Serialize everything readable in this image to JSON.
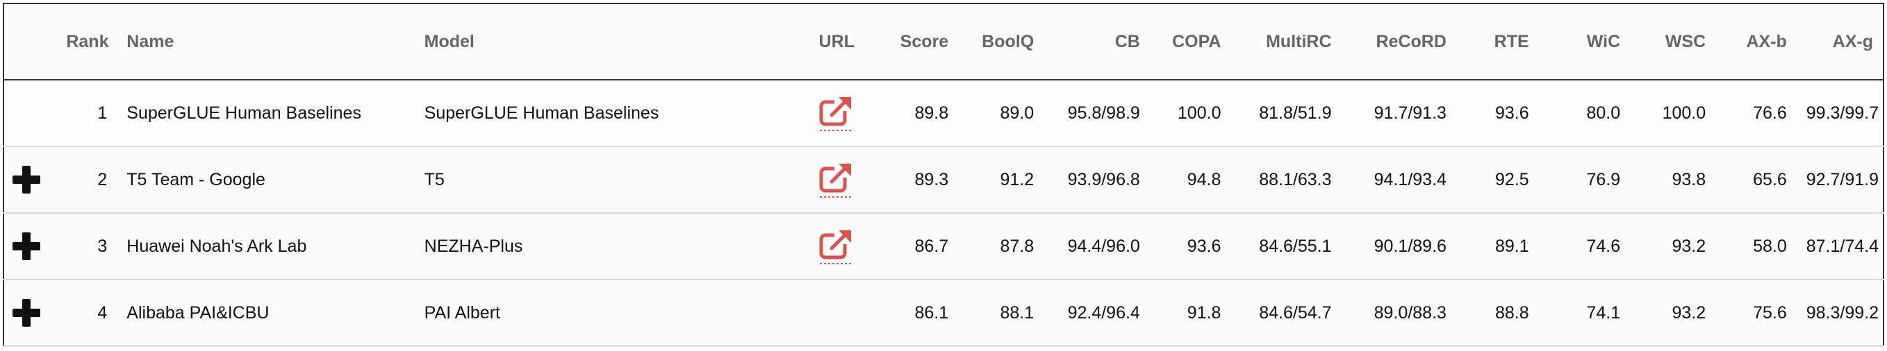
{
  "columns": {
    "rank": "Rank",
    "name": "Name",
    "model": "Model",
    "url": "URL",
    "score": "Score",
    "boolq": "BoolQ",
    "cb": "CB",
    "copa": "COPA",
    "multirc": "MultiRC",
    "record": "ReCoRD",
    "rte": "RTE",
    "wic": "WiC",
    "wsc": "WSC",
    "axb": "AX-b",
    "axg": "AX-g"
  },
  "rows": [
    {
      "rank": "1",
      "name": "SuperGLUE Human Baselines",
      "model": "SuperGLUE Human Baselines",
      "has_url": true,
      "expandable": false,
      "score": "89.8",
      "boolq": "89.0",
      "cb": "95.8/98.9",
      "copa": "100.0",
      "multirc": "81.8/51.9",
      "record": "91.7/91.3",
      "rte": "93.6",
      "wic": "80.0",
      "wsc": "100.0",
      "axb": "76.6",
      "axg": "99.3/99.7"
    },
    {
      "rank": "2",
      "name": "T5 Team - Google",
      "model": "T5",
      "has_url": true,
      "expandable": true,
      "score": "89.3",
      "boolq": "91.2",
      "cb": "93.9/96.8",
      "copa": "94.8",
      "multirc": "88.1/63.3",
      "record": "94.1/93.4",
      "rte": "92.5",
      "wic": "76.9",
      "wsc": "93.8",
      "axb": "65.6",
      "axg": "92.7/91.9"
    },
    {
      "rank": "3",
      "name": "Huawei Noah's Ark Lab",
      "model": "NEZHA-Plus",
      "has_url": true,
      "expandable": true,
      "score": "86.7",
      "boolq": "87.8",
      "cb": "94.4/96.0",
      "copa": "93.6",
      "multirc": "84.6/55.1",
      "record": "90.1/89.6",
      "rte": "89.1",
      "wic": "74.6",
      "wsc": "93.2",
      "axb": "58.0",
      "axg": "87.1/74.4"
    },
    {
      "rank": "4",
      "name": "Alibaba PAI&ICBU",
      "model": "PAI Albert",
      "has_url": false,
      "expandable": true,
      "score": "86.1",
      "boolq": "88.1",
      "cb": "92.4/96.4",
      "copa": "91.8",
      "multirc": "84.6/54.7",
      "record": "89.0/88.3",
      "rte": "88.8",
      "wic": "74.1",
      "wsc": "93.2",
      "axb": "75.6",
      "axg": "98.3/99.2"
    }
  ],
  "icons": {
    "expand": "plus-icon",
    "url": "external-link-icon"
  },
  "colors": {
    "link_icon": "#d9534f",
    "header_text": "#666666",
    "border_dark": "#333333",
    "row_border": "#dcdcdc"
  }
}
